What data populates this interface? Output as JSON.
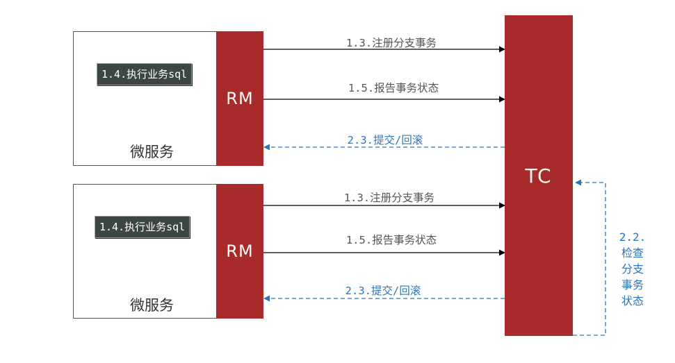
{
  "microservices": [
    {
      "label": "微服务",
      "task": "1.4.执行业务sql",
      "rm_label": "RM",
      "arrows": {
        "register": "1.3.注册分支事务",
        "report": "1.5.报告事务状态",
        "commit_rollback": "2.3.提交/回滚"
      }
    },
    {
      "label": "微服务",
      "task": "1.4.执行业务sql",
      "rm_label": "RM",
      "arrows": {
        "register": "1.3.注册分支事务",
        "report": "1.5.报告事务状态",
        "commit_rollback": "2.3.提交/回滚"
      }
    }
  ],
  "tc": {
    "label": "TC",
    "self_check_lines": [
      "2.2.",
      "检查",
      "分支",
      "事务",
      "状态"
    ]
  },
  "colors": {
    "rm_tc_fill": "#a82a2a",
    "task_fill": "#3c4645",
    "solid_arrow": "#000000",
    "dashed_arrow": "#2e75b6"
  }
}
